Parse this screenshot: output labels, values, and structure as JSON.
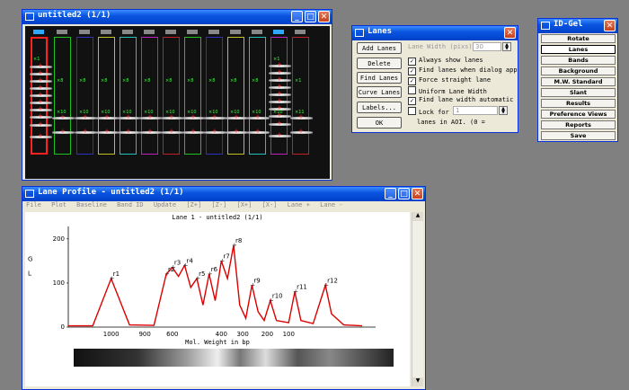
{
  "gel_window": {
    "title": "untitled2 (1/1)",
    "lane_labels_top": [
      "M1",
      "",
      "",
      "",
      "",
      "",
      "",
      "",
      "",
      "",
      "",
      "M8",
      ""
    ],
    "lane_counts": [
      "×1",
      "×8",
      "×8",
      "×8",
      "×8",
      "×8",
      "×8",
      "×8",
      "×8",
      "×8",
      "×8",
      "×1",
      "×1"
    ],
    "lane_counts_low": [
      "",
      "×10",
      "×10",
      "×10",
      "×10",
      "×10",
      "×10",
      "×10",
      "×10",
      "×10",
      "×10",
      "×10",
      "×11"
    ]
  },
  "lanes_dialog": {
    "title": "Lanes",
    "buttons": [
      "Add Lanes",
      "Delete Lanes",
      "Find Lanes",
      "Curve Lanes",
      "Labels...",
      "OK"
    ],
    "lane_width_label": "Lane Width (pixs)",
    "lane_width_value": "30",
    "options": [
      {
        "label": "Always show lanes",
        "checked": true
      },
      {
        "label": "Find lanes when dialog app",
        "checked": true
      },
      {
        "label": "Force straight lane",
        "checked": true
      },
      {
        "label": "Uniform Lane Width",
        "checked": false
      },
      {
        "label": "Find lane width automatic",
        "checked": true
      },
      {
        "label": "Lock for",
        "checked": false
      }
    ],
    "lock_value": "1",
    "lanes_in_aoi": "lanes in AOI.",
    "aoi_value": "(0 ="
  },
  "idgel": {
    "title": "ID-Gel",
    "buttons": [
      "Rotate",
      "Lanes",
      "Bands",
      "Background",
      "M.W. Standard",
      "Slant",
      "Results",
      "Preference Views",
      "Reports",
      "Save"
    ],
    "selected": "Lanes"
  },
  "profile_window": {
    "title": "Lane Profile - untitled2 (1/1)",
    "menu": [
      "File",
      "Plot",
      "Baseline",
      "Band ID",
      "Update",
      "[Z+]",
      "[Z-]",
      "[X+]",
      "[X-]",
      "Lane +",
      "Lane -"
    ],
    "plot_title": "Lane 1 - untitled2 (1/1)",
    "y_ticks": [
      "200",
      "100",
      "0"
    ],
    "y_axis_letters": [
      "G",
      "L"
    ],
    "x_ticks": [
      "1000",
      "900",
      "600",
      "400",
      "300",
      "200",
      "100"
    ],
    "x_label": "Mol. Weight in bp",
    "peak_labels": [
      "r1",
      "r2",
      "r3",
      "r4",
      "r5",
      "r6",
      "r7",
      "r8",
      "r9",
      "r10",
      "r11",
      "r12"
    ],
    "line_color": "#dd0000"
  },
  "chart_data": {
    "type": "line",
    "title": "Lane 1 - untitled2 (1/1)",
    "xlabel": "Mol. Weight in bp",
    "ylabel": "",
    "ylim": [
      0,
      220
    ],
    "x_ticks": [
      "1000",
      "900",
      "600",
      "400",
      "300",
      "200",
      "100"
    ],
    "series": [
      {
        "values": [
          [
            0,
            3
          ],
          [
            4,
            3
          ],
          [
            7,
            110
          ],
          [
            10,
            5
          ],
          [
            14,
            4
          ],
          [
            16,
            120
          ],
          [
            17,
            135
          ],
          [
            18,
            115
          ],
          [
            19,
            140
          ],
          [
            20,
            90
          ],
          [
            21,
            110
          ],
          [
            22,
            50
          ],
          [
            23,
            120
          ],
          [
            24,
            60
          ],
          [
            25,
            150
          ],
          [
            26,
            110
          ],
          [
            27,
            185
          ],
          [
            28,
            50
          ],
          [
            29,
            20
          ],
          [
            30,
            95
          ],
          [
            31,
            35
          ],
          [
            32,
            15
          ],
          [
            33,
            60
          ],
          [
            34,
            15
          ],
          [
            36,
            10
          ],
          [
            37,
            80
          ],
          [
            38,
            15
          ],
          [
            40,
            8
          ],
          [
            42,
            95
          ],
          [
            43,
            30
          ],
          [
            45,
            5
          ],
          [
            48,
            3
          ]
        ]
      }
    ],
    "peak_labels": [
      "r1",
      "r2",
      "r3",
      "r4",
      "r5",
      "r6",
      "r7",
      "r8",
      "r9",
      "r10",
      "r11",
      "r12"
    ]
  }
}
